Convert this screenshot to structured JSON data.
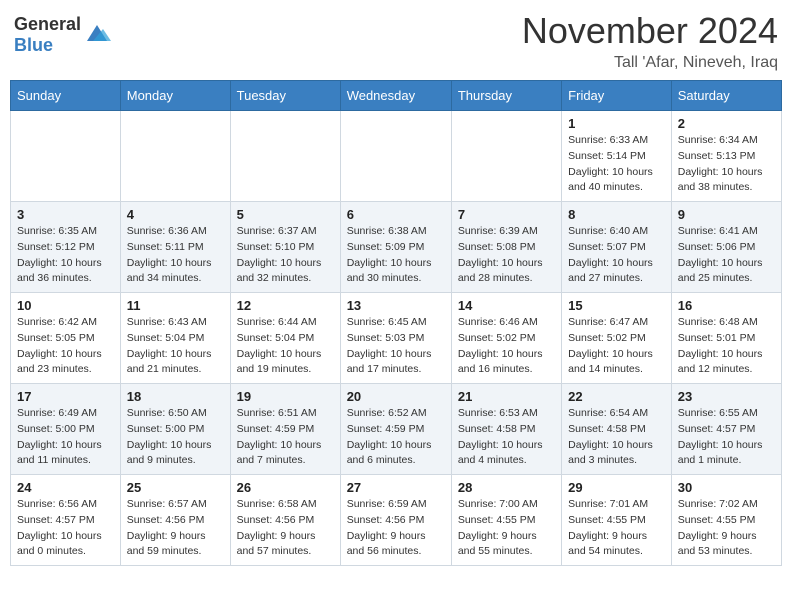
{
  "header": {
    "logo_general": "General",
    "logo_blue": "Blue",
    "month": "November 2024",
    "location": "Tall 'Afar, Nineveh, Iraq"
  },
  "weekdays": [
    "Sunday",
    "Monday",
    "Tuesday",
    "Wednesday",
    "Thursday",
    "Friday",
    "Saturday"
  ],
  "weeks": [
    [
      {
        "day": "",
        "info": ""
      },
      {
        "day": "",
        "info": ""
      },
      {
        "day": "",
        "info": ""
      },
      {
        "day": "",
        "info": ""
      },
      {
        "day": "",
        "info": ""
      },
      {
        "day": "1",
        "info": "Sunrise: 6:33 AM\nSunset: 5:14 PM\nDaylight: 10 hours and 40 minutes."
      },
      {
        "day": "2",
        "info": "Sunrise: 6:34 AM\nSunset: 5:13 PM\nDaylight: 10 hours and 38 minutes."
      }
    ],
    [
      {
        "day": "3",
        "info": "Sunrise: 6:35 AM\nSunset: 5:12 PM\nDaylight: 10 hours and 36 minutes."
      },
      {
        "day": "4",
        "info": "Sunrise: 6:36 AM\nSunset: 5:11 PM\nDaylight: 10 hours and 34 minutes."
      },
      {
        "day": "5",
        "info": "Sunrise: 6:37 AM\nSunset: 5:10 PM\nDaylight: 10 hours and 32 minutes."
      },
      {
        "day": "6",
        "info": "Sunrise: 6:38 AM\nSunset: 5:09 PM\nDaylight: 10 hours and 30 minutes."
      },
      {
        "day": "7",
        "info": "Sunrise: 6:39 AM\nSunset: 5:08 PM\nDaylight: 10 hours and 28 minutes."
      },
      {
        "day": "8",
        "info": "Sunrise: 6:40 AM\nSunset: 5:07 PM\nDaylight: 10 hours and 27 minutes."
      },
      {
        "day": "9",
        "info": "Sunrise: 6:41 AM\nSunset: 5:06 PM\nDaylight: 10 hours and 25 minutes."
      }
    ],
    [
      {
        "day": "10",
        "info": "Sunrise: 6:42 AM\nSunset: 5:05 PM\nDaylight: 10 hours and 23 minutes."
      },
      {
        "day": "11",
        "info": "Sunrise: 6:43 AM\nSunset: 5:04 PM\nDaylight: 10 hours and 21 minutes."
      },
      {
        "day": "12",
        "info": "Sunrise: 6:44 AM\nSunset: 5:04 PM\nDaylight: 10 hours and 19 minutes."
      },
      {
        "day": "13",
        "info": "Sunrise: 6:45 AM\nSunset: 5:03 PM\nDaylight: 10 hours and 17 minutes."
      },
      {
        "day": "14",
        "info": "Sunrise: 6:46 AM\nSunset: 5:02 PM\nDaylight: 10 hours and 16 minutes."
      },
      {
        "day": "15",
        "info": "Sunrise: 6:47 AM\nSunset: 5:02 PM\nDaylight: 10 hours and 14 minutes."
      },
      {
        "day": "16",
        "info": "Sunrise: 6:48 AM\nSunset: 5:01 PM\nDaylight: 10 hours and 12 minutes."
      }
    ],
    [
      {
        "day": "17",
        "info": "Sunrise: 6:49 AM\nSunset: 5:00 PM\nDaylight: 10 hours and 11 minutes."
      },
      {
        "day": "18",
        "info": "Sunrise: 6:50 AM\nSunset: 5:00 PM\nDaylight: 10 hours and 9 minutes."
      },
      {
        "day": "19",
        "info": "Sunrise: 6:51 AM\nSunset: 4:59 PM\nDaylight: 10 hours and 7 minutes."
      },
      {
        "day": "20",
        "info": "Sunrise: 6:52 AM\nSunset: 4:59 PM\nDaylight: 10 hours and 6 minutes."
      },
      {
        "day": "21",
        "info": "Sunrise: 6:53 AM\nSunset: 4:58 PM\nDaylight: 10 hours and 4 minutes."
      },
      {
        "day": "22",
        "info": "Sunrise: 6:54 AM\nSunset: 4:58 PM\nDaylight: 10 hours and 3 minutes."
      },
      {
        "day": "23",
        "info": "Sunrise: 6:55 AM\nSunset: 4:57 PM\nDaylight: 10 hours and 1 minute."
      }
    ],
    [
      {
        "day": "24",
        "info": "Sunrise: 6:56 AM\nSunset: 4:57 PM\nDaylight: 10 hours and 0 minutes."
      },
      {
        "day": "25",
        "info": "Sunrise: 6:57 AM\nSunset: 4:56 PM\nDaylight: 9 hours and 59 minutes."
      },
      {
        "day": "26",
        "info": "Sunrise: 6:58 AM\nSunset: 4:56 PM\nDaylight: 9 hours and 57 minutes."
      },
      {
        "day": "27",
        "info": "Sunrise: 6:59 AM\nSunset: 4:56 PM\nDaylight: 9 hours and 56 minutes."
      },
      {
        "day": "28",
        "info": "Sunrise: 7:00 AM\nSunset: 4:55 PM\nDaylight: 9 hours and 55 minutes."
      },
      {
        "day": "29",
        "info": "Sunrise: 7:01 AM\nSunset: 4:55 PM\nDaylight: 9 hours and 54 minutes."
      },
      {
        "day": "30",
        "info": "Sunrise: 7:02 AM\nSunset: 4:55 PM\nDaylight: 9 hours and 53 minutes."
      }
    ]
  ]
}
